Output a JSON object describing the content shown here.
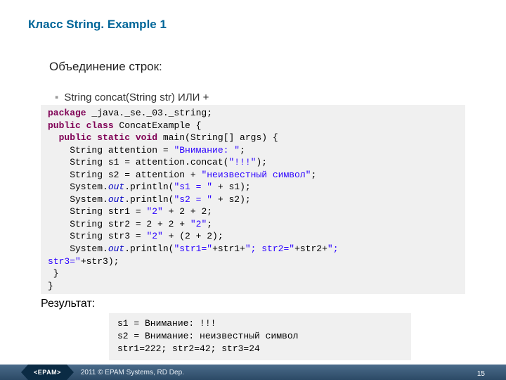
{
  "title": "Класс String. Example 1",
  "subtitle": "Объединение строк:",
  "bullet": "String concat(String str)     ИЛИ        +",
  "code": {
    "l1a": "package",
    "l1b": " _java._se._03._string;",
    "l2a": "public class",
    "l2b": " ConcatExample {",
    "l3a": "  public static void",
    "l3b": " main(String[] args) {",
    "l4": "    String attention = ",
    "l4s": "\"Внимание: \"",
    "l4e": ";",
    "l5": "    String s1 = attention.concat(",
    "l5s": "\"!!!\"",
    "l5e": ");",
    "l6": "    String s2 = attention + ",
    "l6s": "\"неизвестный символ\"",
    "l6e": ";",
    "l7a": "    System.",
    "l7b": "out",
    "l7c": ".println(",
    "l7s": "\"s1 = \"",
    "l7d": " + s1);",
    "l8a": "    System.",
    "l8b": "out",
    "l8c": ".println(",
    "l8s": "\"s2 = \"",
    "l8d": " + s2);",
    "l9": "    String str1 = ",
    "l9s": "\"2\"",
    "l9e": " + 2 + 2;",
    "l10": "    String str2 = 2 + 2 + ",
    "l10s": "\"2\"",
    "l10e": ";",
    "l11": "    String str3 = ",
    "l11s": "\"2\"",
    "l11e": " + (2 + 2);",
    "l12a": "    System.",
    "l12b": "out",
    "l12c": ".println(",
    "l12s1": "\"str1=\"",
    "l12d": "+str1+",
    "l12s2": "\"; str2=\"",
    "l12e": "+str2+",
    "l12s3": "\";",
    "l13a": "str3=\"",
    "l13b": "+str3);",
    "l14": " }",
    "l15": "}"
  },
  "result_label": "Результат:",
  "output": "s1 = Внимание: !!!\ns2 = Внимание: неизвестный символ\nstr1=222; str2=42; str3=24",
  "footer": {
    "brand": "<EPAM>",
    "copyright": "2011 © EPAM Systems, RD Dep.",
    "page": "15"
  }
}
